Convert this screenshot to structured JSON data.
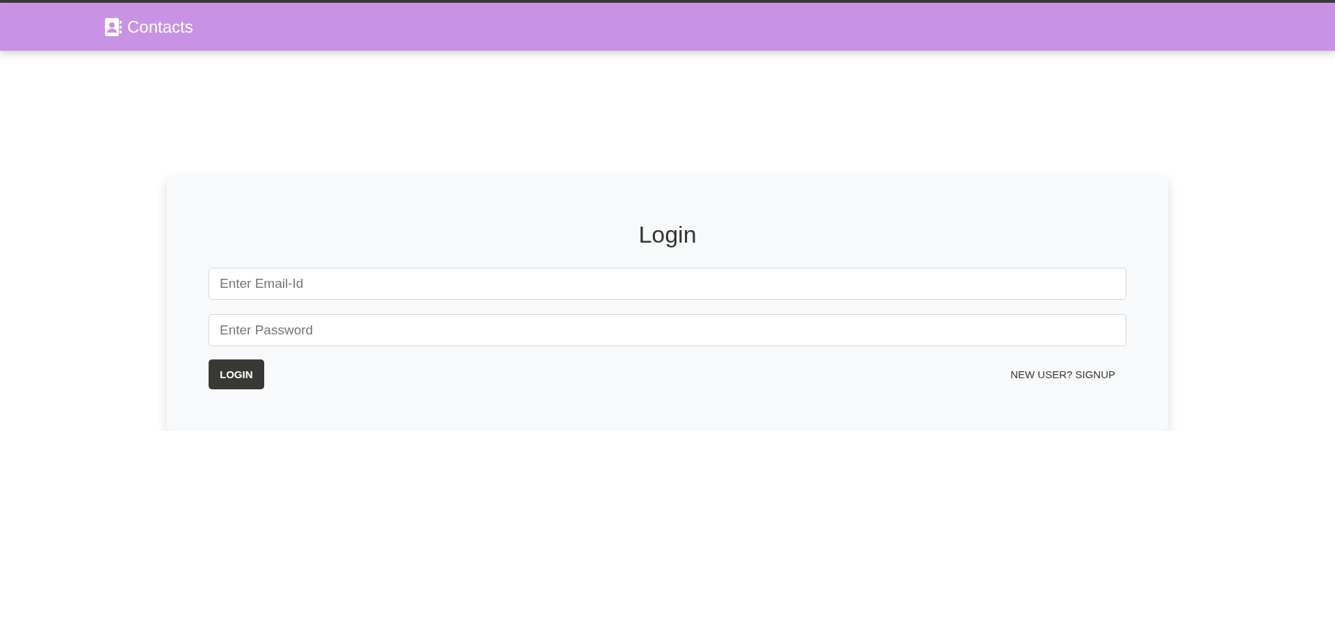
{
  "navbar": {
    "brand": "Contacts"
  },
  "login": {
    "title": "Login",
    "fields": [
      {
        "placeholder": "Enter Email-Id"
      },
      {
        "placeholder": "Enter Password"
      }
    ],
    "submit": "LOGIN",
    "signup_link": "NEW USER? SIGNUP"
  }
}
